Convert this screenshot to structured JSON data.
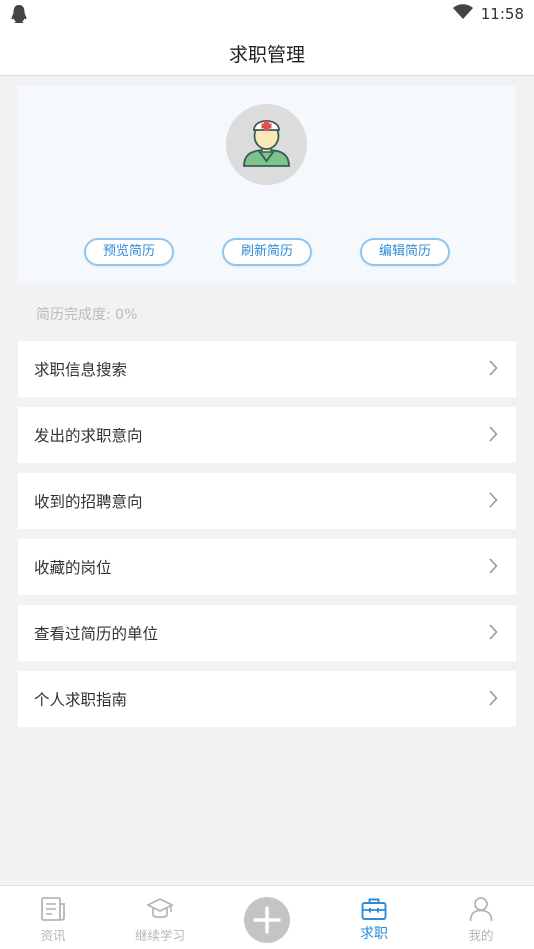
{
  "status_bar": {
    "time": "11:58",
    "left_icon": "qq-penguin-icon",
    "signal_icon": "wifi-icon"
  },
  "header": {
    "title": "求职管理"
  },
  "profile": {
    "avatar_icon": "doctor-avatar-icon",
    "buttons": {
      "preview": "预览简历",
      "refresh": "刷新简历",
      "edit": "编辑简历"
    },
    "completion_text": "简历完成度: 0%"
  },
  "menu": {
    "items": [
      {
        "label": "求职信息搜索"
      },
      {
        "label": "发出的求职意向"
      },
      {
        "label": "收到的招聘意向"
      },
      {
        "label": "收藏的岗位"
      },
      {
        "label": "查看过简历的单位"
      },
      {
        "label": "个人求职指南"
      }
    ],
    "chevron_icon": "chevron-right-icon"
  },
  "bottom_nav": {
    "items": [
      {
        "label": "资讯",
        "icon": "news-icon"
      },
      {
        "label": "继续学习",
        "icon": "graduation-cap-icon"
      },
      {
        "label": "",
        "icon": "plus-icon"
      },
      {
        "label": "求职",
        "icon": "briefcase-icon",
        "active": true
      },
      {
        "label": "我的",
        "icon": "person-icon"
      }
    ]
  },
  "colors": {
    "accent": "#2d8bd8",
    "button_border": "#8fc7ee",
    "card_bg": "#f5f9fd",
    "page_bg": "#f2f2f2",
    "inactive_nav": "#b5b5b5"
  }
}
